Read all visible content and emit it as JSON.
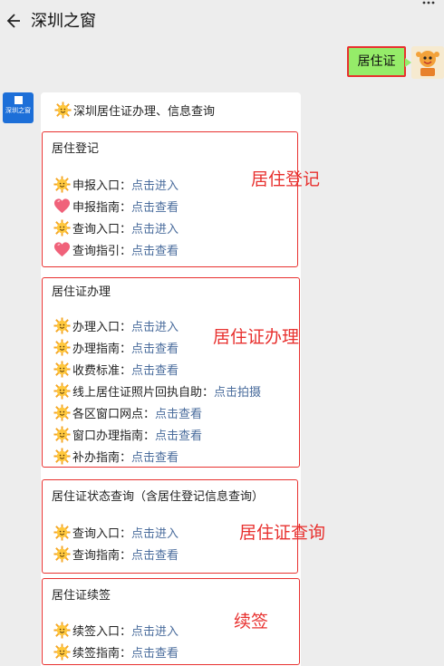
{
  "header": {
    "title": "深圳之窗"
  },
  "my_message": "居住证",
  "oa": {
    "avatar_label": "深圳之窗"
  },
  "card": {
    "title": "深圳居住证办理、信息查询",
    "sections": [
      {
        "title": "居住登记",
        "annotation": "居住登记",
        "rows": [
          {
            "icon": "sun",
            "label": "申报入口：",
            "link": "点击进入"
          },
          {
            "icon": "heart",
            "label": "申报指南：",
            "link": "点击查看"
          },
          {
            "icon": "sun",
            "label": "查询入口：",
            "link": "点击进入"
          },
          {
            "icon": "heart",
            "label": "查询指引：",
            "link": "点击查看"
          }
        ]
      },
      {
        "title": "居住证办理",
        "annotation": "居住证办理",
        "rows": [
          {
            "icon": "sun",
            "label": "办理入口：",
            "link": "点击进入"
          },
          {
            "icon": "sun",
            "label": "办理指南：",
            "link": "点击查看"
          },
          {
            "icon": "sun",
            "label": "收费标准：",
            "link": "点击查看"
          },
          {
            "icon": "sun",
            "label": "线上居住证照片回执自助：",
            "link": "点击拍摄"
          },
          {
            "icon": "sun",
            "label": "各区窗口网点：",
            "link": "点击查看"
          },
          {
            "icon": "sun",
            "label": "窗口办理指南：",
            "link": "点击查看"
          },
          {
            "icon": "sun",
            "label": "补办指南：",
            "link": "点击查看"
          }
        ]
      },
      {
        "title": "居住证状态查询（含居住登记信息查询）",
        "annotation": "居住证查询",
        "rows": [
          {
            "icon": "sun",
            "label": "查询入口：",
            "link": "点击进入"
          },
          {
            "icon": "sun",
            "label": "查询指南：",
            "link": "点击查看"
          }
        ]
      },
      {
        "title": "居住证续签",
        "annotation": "续签",
        "rows": [
          {
            "icon": "sun",
            "label": "续签入口：",
            "link": "点击进入"
          },
          {
            "icon": "sun",
            "label": "续签指南：",
            "link": "点击查看"
          }
        ]
      }
    ]
  }
}
